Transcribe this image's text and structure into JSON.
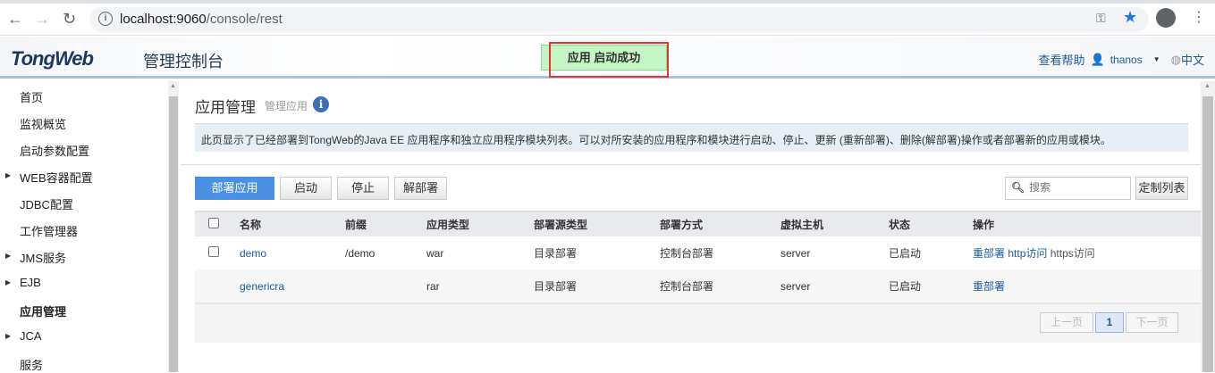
{
  "browser": {
    "url_host": "localhost:9060",
    "url_path": "/console/rest"
  },
  "header": {
    "logo": "TongWeb",
    "logo_suffix": "管理控制台",
    "toast": "应用 启动成功",
    "help": "查看帮助",
    "user": "thanos",
    "language": "中文"
  },
  "sidebar": {
    "items": [
      {
        "label": "首页",
        "expandable": false
      },
      {
        "label": "监视概览",
        "expandable": false
      },
      {
        "label": "启动参数配置",
        "expandable": false
      },
      {
        "label": "WEB容器配置",
        "expandable": true
      },
      {
        "label": "JDBC配置",
        "expandable": false
      },
      {
        "label": "工作管理器",
        "expandable": false
      },
      {
        "label": "JMS服务",
        "expandable": true
      },
      {
        "label": "EJB",
        "expandable": true
      },
      {
        "label": "应用管理",
        "expandable": false,
        "active": true
      },
      {
        "label": "JCA",
        "expandable": true
      },
      {
        "label": "服务",
        "expandable": false
      }
    ]
  },
  "page": {
    "title": "应用管理",
    "subtitle": "管理应用",
    "description": "此页显示了已经部署到TongWeb的Java EE 应用程序和独立应用程序模块列表。可以对所安装的应用程序和模块进行启动、停止、更新 (重新部署)、删除(解部署)操作或者部署新的应用或模块。"
  },
  "toolbar": {
    "deploy": "部署应用",
    "start": "启动",
    "stop": "停止",
    "undeploy": "解部署",
    "search_placeholder": "搜索",
    "customize": "定制列表"
  },
  "table": {
    "columns": [
      "名称",
      "前缀",
      "应用类型",
      "部署源类型",
      "部署方式",
      "虚拟主机",
      "状态",
      "操作"
    ],
    "rows": [
      {
        "name": "demo",
        "prefix": "/demo",
        "type": "war",
        "source": "目录部署",
        "method": "控制台部署",
        "host": "server",
        "status": "已启动",
        "actions": [
          "重部署",
          "http访问",
          "https访问"
        ]
      },
      {
        "name": "genericra",
        "prefix": "",
        "type": "rar",
        "source": "目录部署",
        "method": "控制台部署",
        "host": "server",
        "status": "已启动",
        "actions": [
          "重部署"
        ]
      }
    ]
  },
  "pagination": {
    "prev": "上一页",
    "current": "1",
    "next": "下一页"
  }
}
